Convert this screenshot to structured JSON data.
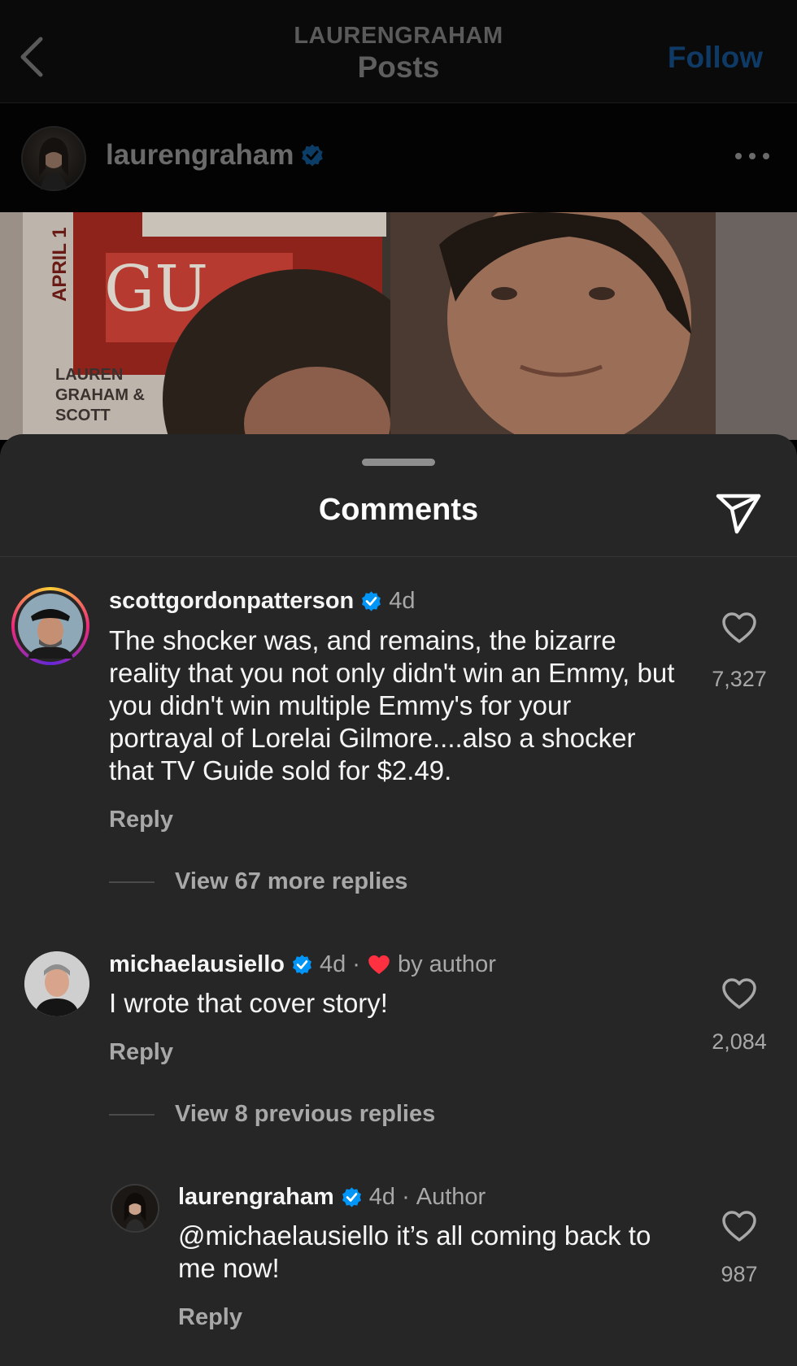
{
  "header": {
    "username": "LAURENGRAHAM",
    "title": "Posts",
    "follow_label": "Follow"
  },
  "post": {
    "username": "laurengraham",
    "more_icon": "more-horizontal-icon"
  },
  "photo": {
    "cover_text_april": "APRIL 1",
    "cover_text_guide": "GU",
    "cover_names": "LAUREN\nGRAHAM &\nSCOTT",
    "colors": {
      "red": "#d42a22",
      "skin": "#b9826a"
    }
  },
  "comments_sheet": {
    "title": "Comments",
    "share_icon": "send-icon",
    "comments": [
      {
        "username": "scottgordonpatterson",
        "verified": true,
        "age": "4d",
        "text": "The shocker was, and remains, the bizarre reality that you not only didn't win an Emmy, but you didn't win multiple Emmy's for your portrayal of Lorelai Gilmore....also a shocker that TV Guide sold for $2.49.",
        "reply_label": "Reply",
        "like_count": "7,327",
        "view_replies": "View 67 more replies"
      },
      {
        "username": "michaelausiello",
        "verified": true,
        "age": "4d",
        "separator": "·",
        "liked_by": "by author",
        "text": "I wrote that cover story!",
        "reply_label": "Reply",
        "like_count": "2,084",
        "view_replies": "View 8 previous replies"
      },
      {
        "username": "laurengraham",
        "verified": true,
        "age": "4d",
        "separator": "·",
        "role": "Author",
        "mention": "@michaelausiello",
        "text": " it’s all coming back to me now!",
        "reply_label": "Reply",
        "like_count": "987"
      }
    ]
  },
  "colors": {
    "verified": "#0095f6",
    "heart_red": "#ff3040",
    "sheet_bg": "#262626"
  }
}
